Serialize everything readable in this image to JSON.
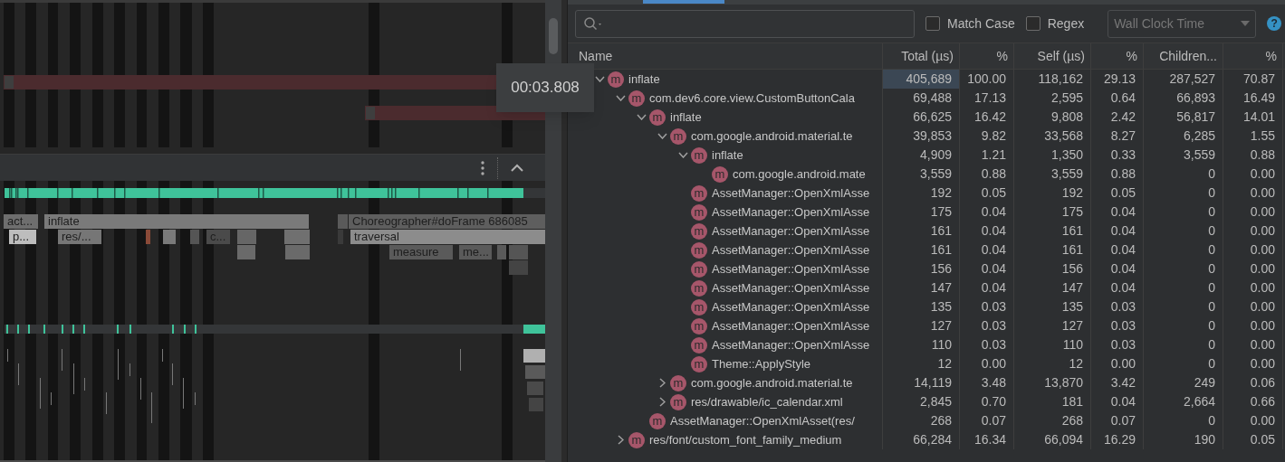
{
  "timeline": {
    "tooltip": "00:03.808",
    "slices": [
      {
        "label": "act..."
      },
      {
        "label": "inflate"
      },
      {
        "label": "Choreographer#doFrame 686085"
      },
      {
        "label": "p..."
      },
      {
        "label": "res/..."
      },
      {
        "label": "c..."
      },
      {
        "label": "traversal"
      },
      {
        "label": "measure"
      },
      {
        "label": "me..."
      }
    ]
  },
  "options": [
    {
      "label": "Match Case",
      "checked": false
    },
    {
      "label": "Regex",
      "checked": false
    }
  ],
  "clock_select": {
    "value": "Wall Clock Time",
    "disabled": true
  },
  "help": {
    "label": "?"
  },
  "table": {
    "columns": [
      "Name",
      "Total (µs)",
      "%",
      "Self (µs)",
      "%",
      "Children...",
      "%"
    ],
    "rows": [
      {
        "icon": "m",
        "name": "inflate",
        "expanded": true,
        "values": [
          "405,689",
          "100.00",
          "118,162",
          "29.13",
          "287,527",
          "70.87"
        ],
        "children": [
          {
            "icon": "m",
            "name": "com.dev6.core.view.CustomButtonCala",
            "expanded": true,
            "values": [
              "69,488",
              "17.13",
              "2,595",
              "0.64",
              "66,893",
              "16.49"
            ],
            "children": [
              {
                "icon": "m",
                "name": "inflate",
                "expanded": true,
                "values": [
                  "66,625",
                  "16.42",
                  "9,808",
                  "2.42",
                  "56,817",
                  "14.01"
                ],
                "children": [
                  {
                    "icon": "m",
                    "name": "com.google.android.material.te",
                    "expanded": true,
                    "values": [
                      "39,853",
                      "9.82",
                      "33,568",
                      "8.27",
                      "6,285",
                      "1.55"
                    ],
                    "children": [
                      {
                        "icon": "m",
                        "name": "inflate",
                        "expanded": true,
                        "values": [
                          "4,909",
                          "1.21",
                          "1,350",
                          "0.33",
                          "3,559",
                          "0.88"
                        ],
                        "children": [
                          {
                            "icon": "m",
                            "name": "com.google.android.mate",
                            "values": [
                              "3,559",
                              "0.88",
                              "3,559",
                              "0.88",
                              "0",
                              "0.00"
                            ]
                          }
                        ]
                      },
                      {
                        "icon": "m",
                        "name": "AssetManager::OpenXmlAsse",
                        "values": [
                          "192",
                          "0.05",
                          "192",
                          "0.05",
                          "0",
                          "0.00"
                        ]
                      },
                      {
                        "icon": "m",
                        "name": "AssetManager::OpenXmlAsse",
                        "values": [
                          "175",
                          "0.04",
                          "175",
                          "0.04",
                          "0",
                          "0.00"
                        ]
                      },
                      {
                        "icon": "m",
                        "name": "AssetManager::OpenXmlAsse",
                        "values": [
                          "161",
                          "0.04",
                          "161",
                          "0.04",
                          "0",
                          "0.00"
                        ]
                      },
                      {
                        "icon": "m",
                        "name": "AssetManager::OpenXmlAsse",
                        "values": [
                          "161",
                          "0.04",
                          "161",
                          "0.04",
                          "0",
                          "0.00"
                        ]
                      },
                      {
                        "icon": "m",
                        "name": "AssetManager::OpenXmlAsse",
                        "values": [
                          "156",
                          "0.04",
                          "156",
                          "0.04",
                          "0",
                          "0.00"
                        ]
                      },
                      {
                        "icon": "m",
                        "name": "AssetManager::OpenXmlAsse",
                        "values": [
                          "147",
                          "0.04",
                          "147",
                          "0.04",
                          "0",
                          "0.00"
                        ]
                      },
                      {
                        "icon": "m",
                        "name": "AssetManager::OpenXmlAsse",
                        "values": [
                          "135",
                          "0.03",
                          "135",
                          "0.03",
                          "0",
                          "0.00"
                        ]
                      },
                      {
                        "icon": "m",
                        "name": "AssetManager::OpenXmlAsse",
                        "values": [
                          "127",
                          "0.03",
                          "127",
                          "0.03",
                          "0",
                          "0.00"
                        ]
                      },
                      {
                        "icon": "m",
                        "name": "AssetManager::OpenXmlAsse",
                        "values": [
                          "110",
                          "0.03",
                          "110",
                          "0.03",
                          "0",
                          "0.00"
                        ]
                      },
                      {
                        "icon": "m",
                        "name": "Theme::ApplyStyle",
                        "values": [
                          "12",
                          "0.00",
                          "12",
                          "0.00",
                          "0",
                          "0.00"
                        ]
                      }
                    ]
                  },
                  {
                    "icon": "m",
                    "name": "com.google.android.material.te",
                    "expanded": false,
                    "values": [
                      "14,119",
                      "3.48",
                      "13,870",
                      "3.42",
                      "249",
                      "0.06"
                    ]
                  },
                  {
                    "icon": "m",
                    "name": "res/drawable/ic_calendar.xml",
                    "expanded": false,
                    "values": [
                      "2,845",
                      "0.70",
                      "181",
                      "0.04",
                      "2,664",
                      "0.66"
                    ]
                  }
                ]
              },
              {
                "icon": "m",
                "name": "AssetManager::OpenXmlAsset(res/",
                "values": [
                  "268",
                  "0.07",
                  "268",
                  "0.07",
                  "0",
                  "0.00"
                ]
              }
            ]
          },
          {
            "icon": "m",
            "name": "res/font/custom_font_family_medium",
            "expanded": false,
            "values": [
              "66,284",
              "16.34",
              "66,094",
              "16.29",
              "190",
              "0.05"
            ]
          }
        ]
      }
    ]
  }
}
